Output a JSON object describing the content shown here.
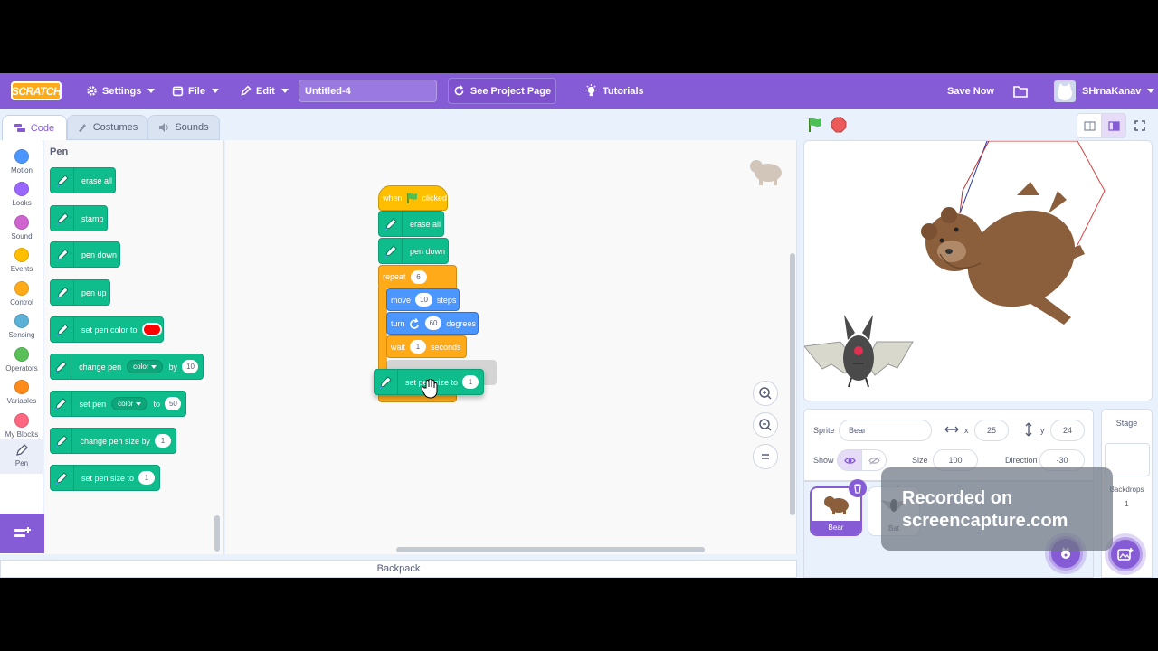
{
  "menubar": {
    "logo": "SCRATCH",
    "settings": "Settings",
    "file": "File",
    "edit": "Edit",
    "project_title": "Untitled-4",
    "see_project_page": "See Project Page",
    "tutorials": "Tutorials",
    "save_now": "Save Now",
    "username": "SHrnaKanav"
  },
  "tabs": {
    "code": "Code",
    "costumes": "Costumes",
    "sounds": "Sounds"
  },
  "categories": [
    {
      "label": "Motion",
      "color": "#4c97ff"
    },
    {
      "label": "Looks",
      "color": "#9966ff"
    },
    {
      "label": "Sound",
      "color": "#cf63cf"
    },
    {
      "label": "Events",
      "color": "#ffbf00"
    },
    {
      "label": "Control",
      "color": "#ffab19"
    },
    {
      "label": "Sensing",
      "color": "#5cb1d6"
    },
    {
      "label": "Operators",
      "color": "#59c059"
    },
    {
      "label": "Variables",
      "color": "#ff8c1a"
    },
    {
      "label": "My Blocks",
      "color": "#ff6680"
    },
    {
      "label": "Pen",
      "color": "#0fbd8c"
    }
  ],
  "palette": {
    "title": "Pen",
    "blocks": {
      "erase_all": "erase all",
      "stamp": "stamp",
      "pen_down": "pen down",
      "pen_up": "pen up",
      "set_pen_color_to": "set pen color to",
      "pen_color_value": "#ff0000",
      "change_pen": "change pen",
      "change_pen_dd": "color",
      "by": "by",
      "change_pen_by_value": "10",
      "set_pen": "set pen",
      "set_pen_dd": "color",
      "to": "to",
      "set_pen_to_value": "50",
      "change_pen_size_by": "change pen size by",
      "change_pen_size_value": "1",
      "set_pen_size_to": "set pen size to",
      "set_pen_size_value": "1"
    }
  },
  "script": {
    "when_flag": "when",
    "clicked": "clicked",
    "erase_all": "erase all",
    "pen_down": "pen down",
    "repeat": "repeat",
    "repeat_count": "6",
    "move": "move",
    "move_value": "10",
    "steps": "steps",
    "turn": "turn",
    "turn_value": "60",
    "degrees": "degrees",
    "wait": "wait",
    "wait_value": "1",
    "seconds": "seconds",
    "dragging_block": "set pen size to",
    "dragging_value": "1"
  },
  "backpack": "Backpack",
  "sprite_info": {
    "sprite_label": "Sprite",
    "sprite_name": "Bear",
    "x_label": "x",
    "x_value": "25",
    "y_label": "y",
    "y_value": "24",
    "show_label": "Show",
    "size_label": "Size",
    "size_value": "100",
    "direction_label": "Direction",
    "direction_value": "-30"
  },
  "sprites": [
    {
      "name": "Bear"
    },
    {
      "name": "Bat"
    }
  ],
  "stage_panel": {
    "title": "Stage",
    "backdrops_label": "Backdrops",
    "backdrops_count": "1"
  },
  "watermark": {
    "line1": "Recorded on",
    "line2": "screencapture.com"
  }
}
